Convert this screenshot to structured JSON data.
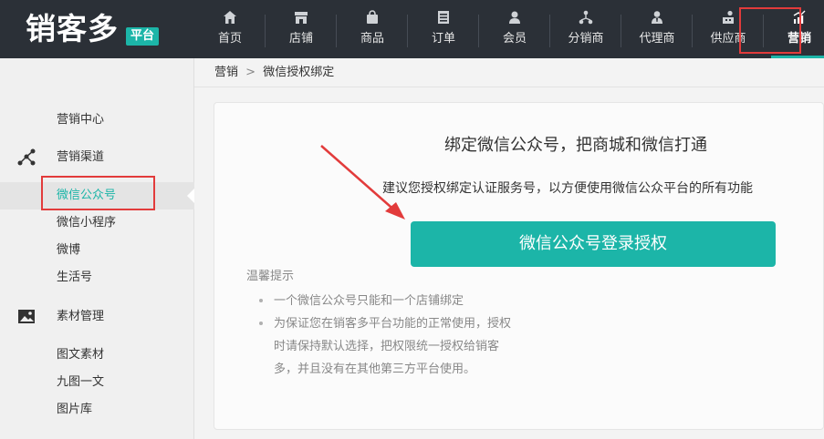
{
  "app": {
    "logo_text": "销客多",
    "logo_badge": "平台"
  },
  "nav": {
    "items": [
      {
        "label": "首页",
        "icon": "home-icon"
      },
      {
        "label": "店铺",
        "icon": "store-icon"
      },
      {
        "label": "商品",
        "icon": "bag-icon"
      },
      {
        "label": "订单",
        "icon": "order-icon"
      },
      {
        "label": "会员",
        "icon": "member-icon"
      },
      {
        "label": "分销商",
        "icon": "distribution-icon"
      },
      {
        "label": "代理商",
        "icon": "agent-icon"
      },
      {
        "label": "供应商",
        "icon": "supplier-icon"
      },
      {
        "label": "营销",
        "icon": "marketing-chart-icon"
      }
    ],
    "active": "营销"
  },
  "breadcrumb": {
    "parent": "营销",
    "separator": ">",
    "current": "微信授权绑定"
  },
  "sidebar": {
    "items": [
      {
        "label": "营销中心"
      },
      {
        "label": "营销渠道",
        "icon": "channel-icon"
      },
      {
        "label": "微信公众号"
      },
      {
        "label": "微信小程序"
      },
      {
        "label": "微博"
      },
      {
        "label": "生活号"
      },
      {
        "label": "素材管理",
        "icon": "image-icon"
      },
      {
        "label": "图文素材"
      },
      {
        "label": "九图一文"
      },
      {
        "label": "图片库"
      }
    ],
    "active": "微信公众号"
  },
  "main": {
    "title": "绑定微信公众号，把商城和微信打通",
    "subtitle": "建议您授权绑定认证服务号，以方便使用微信公众平台的所有功能",
    "auth_button": "微信公众号登录授权",
    "tips_title": "温馨提示",
    "tips": [
      "一个微信公众号只能和一个店铺绑定",
      "为保证您在销客多平台功能的正常使用，授权时请保持默认选择，把权限统一授权给销客多，并且没有在其他第三方平台使用。"
    ]
  },
  "colors": {
    "accent": "#1cb5a8",
    "topbar": "#2b3037",
    "annotation": "#e23b3b"
  }
}
